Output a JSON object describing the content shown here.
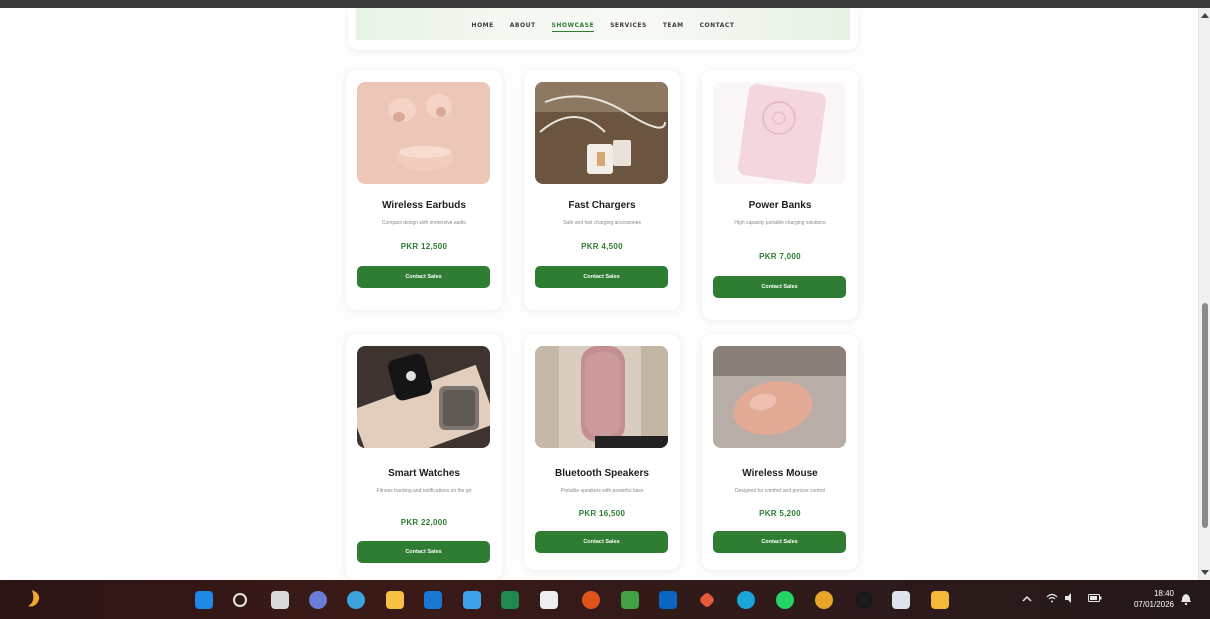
{
  "nav": {
    "items": [
      "HOME",
      "ABOUT",
      "SHOWCASE",
      "SERVICES",
      "TEAM",
      "CONTACT"
    ],
    "active_index": 2
  },
  "products": [
    {
      "name": "Wireless Earbuds",
      "desc": "Compact design with immersive audio",
      "price": "PKR 12,500",
      "button": "Contact Sales",
      "image": "earbuds-photo"
    },
    {
      "name": "Fast Chargers",
      "desc": "Safe and fast charging accessories",
      "price": "PKR 4,500",
      "button": "Contact Sales",
      "image": "charger-photo"
    },
    {
      "name": "Power Banks",
      "desc": "High capacity portable charging solutions",
      "price": "PKR 7,000",
      "button": "Contact Sales",
      "image": "powerbank-photo"
    },
    {
      "name": "Smart Watches",
      "desc": "Fitness tracking and notifications on the go",
      "price": "PKR 22,000",
      "button": "Contact Sales",
      "image": "smartwatch-photo"
    },
    {
      "name": "Bluetooth Speakers",
      "desc": "Portable speakers with powerful bass",
      "price": "PKR 16,500",
      "button": "Contact Sales",
      "image": "speaker-photo"
    },
    {
      "name": "Wireless Mouse",
      "desc": "Designed for comfort and precise control",
      "price": "PKR 5,200",
      "button": "Contact Sales",
      "image": "mouse-photo"
    }
  ],
  "taskbar": {
    "clock_time": "18:40",
    "clock_date": "07/01/2026",
    "apps": [
      "start-icon",
      "search-icon",
      "task-view-icon",
      "chat-icon",
      "copilot-icon",
      "file-explorer-icon",
      "mail-icon",
      "notepad-icon",
      "excel-icon",
      "calendar-icon",
      "powerpoint-icon",
      "photos-icon",
      "linkedin-icon",
      "app-icon",
      "edge-icon",
      "whatsapp-icon",
      "chrome-icon",
      "app-dark-icon",
      "app-doc-icon",
      "folder-icon"
    ]
  },
  "colors": {
    "accent": "#2e7d32",
    "taskbar": "#2b1414"
  }
}
